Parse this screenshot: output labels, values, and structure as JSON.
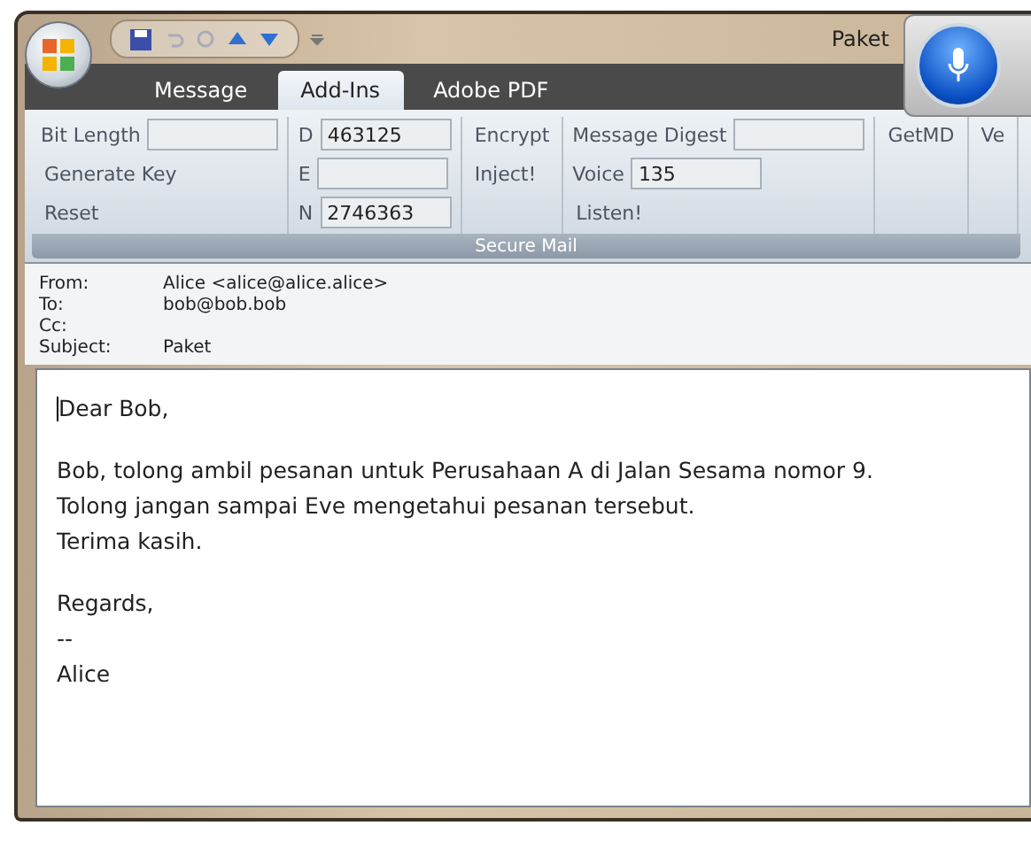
{
  "window": {
    "title": "Paket"
  },
  "tabs": [
    {
      "label": "Message",
      "selected": false
    },
    {
      "label": "Add-Ins",
      "selected": true
    },
    {
      "label": "Adobe PDF",
      "selected": false
    }
  ],
  "ribbon": {
    "columns": [
      {
        "items": [
          {
            "kind": "field",
            "label": "Bit Length"
          },
          {
            "kind": "button",
            "label": "Generate Key"
          },
          {
            "kind": "button",
            "label": "Reset"
          }
        ]
      },
      {
        "items": [
          {
            "kind": "field",
            "label": "D",
            "value": "463125"
          },
          {
            "kind": "field",
            "label": "E"
          },
          {
            "kind": "field",
            "label": "N",
            "value": "2746363"
          }
        ]
      },
      {
        "items": [
          {
            "kind": "button",
            "label": "Encrypt"
          },
          {
            "kind": "button",
            "label": "Inject!"
          }
        ]
      },
      {
        "items": [
          {
            "kind": "field",
            "label": "Message Digest"
          },
          {
            "kind": "field",
            "label": "Voice",
            "value": "135"
          },
          {
            "kind": "button",
            "label": "Listen!"
          }
        ]
      },
      {
        "items": [
          {
            "kind": "button",
            "label": "GetMD"
          }
        ]
      },
      {
        "items": [
          {
            "kind": "button",
            "label": "Ve"
          }
        ]
      }
    ],
    "group_label": "Secure Mail"
  },
  "header": [
    {
      "label": "From:",
      "value": "Alice <alice@alice.alice>"
    },
    {
      "label": "To:",
      "value": "bob@bob.bob"
    },
    {
      "label": "Cc:"
    },
    {
      "label": "Subject:",
      "value": "Paket"
    }
  ],
  "body": [
    [
      "Dear Bob,"
    ],
    [
      "Bob, tolong ambil pesanan untuk Perusahaan A di Jalan Sesama nomor 9.",
      "Tolong jangan sampai Eve mengetahui pesanan tersebut.",
      "Terima kasih."
    ],
    [
      "Regards,",
      "--",
      "Alice"
    ]
  ]
}
